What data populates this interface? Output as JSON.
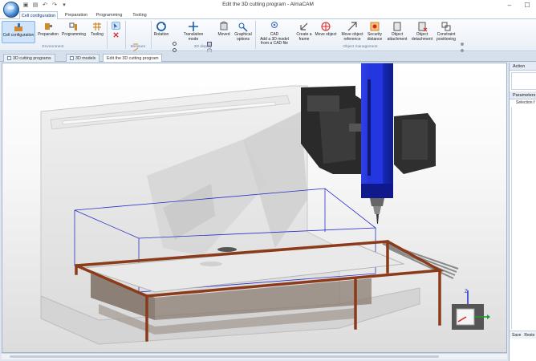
{
  "window": {
    "title": "Edit the 3D cutting program - AlmaCAM",
    "qat_icons": [
      "save-icon",
      "print-icon",
      "undo-icon",
      "redo-icon",
      "dropdown-icon"
    ]
  },
  "ribbon_tabs": [
    {
      "label": "Cell configuration",
      "active": true
    },
    {
      "label": "Preparation",
      "active": false
    },
    {
      "label": "Programming",
      "active": false
    },
    {
      "label": "Tooling",
      "active": false
    }
  ],
  "ribbon": {
    "environment": {
      "label": "Environment",
      "buttons": [
        "Cell configuration",
        "Preparation",
        "Programming",
        "Tooling"
      ]
    },
    "measure": {
      "label": "Measure"
    },
    "display": {
      "label": "3D display",
      "buttons": [
        "Rotation",
        "Translation mode",
        "Moved",
        "Graphical options"
      ]
    },
    "object_management": {
      "label": "Object management",
      "cad_tag": "CAD",
      "buttons": [
        "Add a 3D model from a CAD file",
        "Create a frame",
        "Move object",
        "Move object reference",
        "Security distance",
        "Object attachment",
        "Object detachment",
        "Constraint positioning"
      ]
    }
  },
  "doc_tabs": [
    {
      "label": "3D cutting programs",
      "active": false
    },
    {
      "label": "3D models",
      "active": false
    },
    {
      "label": "Edit the 3D cutting program",
      "active": true
    }
  ],
  "right_panel": {
    "action_header": "Action",
    "parameters_header": "Parameters",
    "selection_label": "Selection f",
    "save_label": "Save",
    "restore_label": "Resto"
  },
  "viewport": {
    "axis_z_label": "Z",
    "colors": {
      "spindle_blue": "#1a2fd0",
      "table_frame": "#8b3a1a",
      "wireframe": "#2830c8",
      "background": "#f5f5f5"
    }
  }
}
